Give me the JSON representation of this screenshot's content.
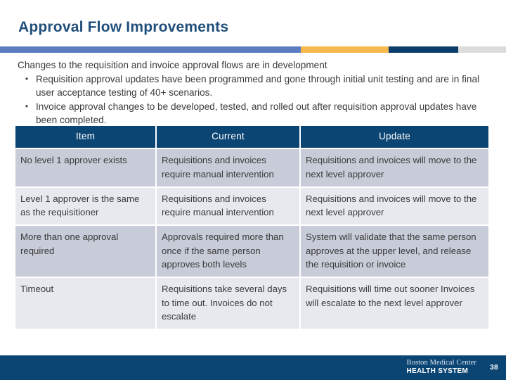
{
  "slide": {
    "title": "Approval Flow Improvements",
    "title_color": "#1F4E79"
  },
  "accent_bar": {
    "segments": [
      {
        "name": "blue",
        "color": "#5B7CBF"
      },
      {
        "name": "orange",
        "color": "#F6B94C"
      },
      {
        "name": "navy",
        "color": "#0B3D6B"
      },
      {
        "name": "gray",
        "color": "#DCDCDC"
      }
    ]
  },
  "body": {
    "lead": "Changes to the requisition and invoice approval flows are in development",
    "bullet_mark": "•",
    "bullets": [
      "Requisition approval updates have been programmed and gone through initial unit testing and are in final user acceptance testing of 40+ scenarios.",
      "Invoice approval changes to be developed, tested, and rolled out after requisition approval updates have been completed."
    ]
  },
  "table": {
    "header_color": "#0B4574",
    "row_colors": [
      "#C7CCD8",
      "#E7E9EF"
    ],
    "columns": [
      "Item",
      "Current",
      "Update"
    ],
    "rows": [
      {
        "item": "No level 1 approver exists",
        "current": "Requisitions and invoices require manual intervention",
        "update": "Requisitions and invoices will move to the next level approver"
      },
      {
        "item": "Level 1 approver is the same as the requisitioner",
        "current": "Requisitions and invoices require manual intervention",
        "update": "Requisitions and invoices will move to the next level approver"
      },
      {
        "item": "More than one approval required",
        "current": "Approvals required more than once if the same person approves both levels",
        "update": "System will validate that the same person approves at the upper level, and release the requisition or invoice"
      },
      {
        "item": "Timeout",
        "current": "Requisitions take several days to time out. Invoices do not escalate",
        "update": "Requisitions will time out sooner Invoices will escalate to the next level approver"
      }
    ]
  },
  "footer": {
    "bar_color": "#0B4574",
    "logo_name": "Boston Medical Center",
    "logo_sub": "HEALTH SYSTEM",
    "page_number": "38"
  }
}
